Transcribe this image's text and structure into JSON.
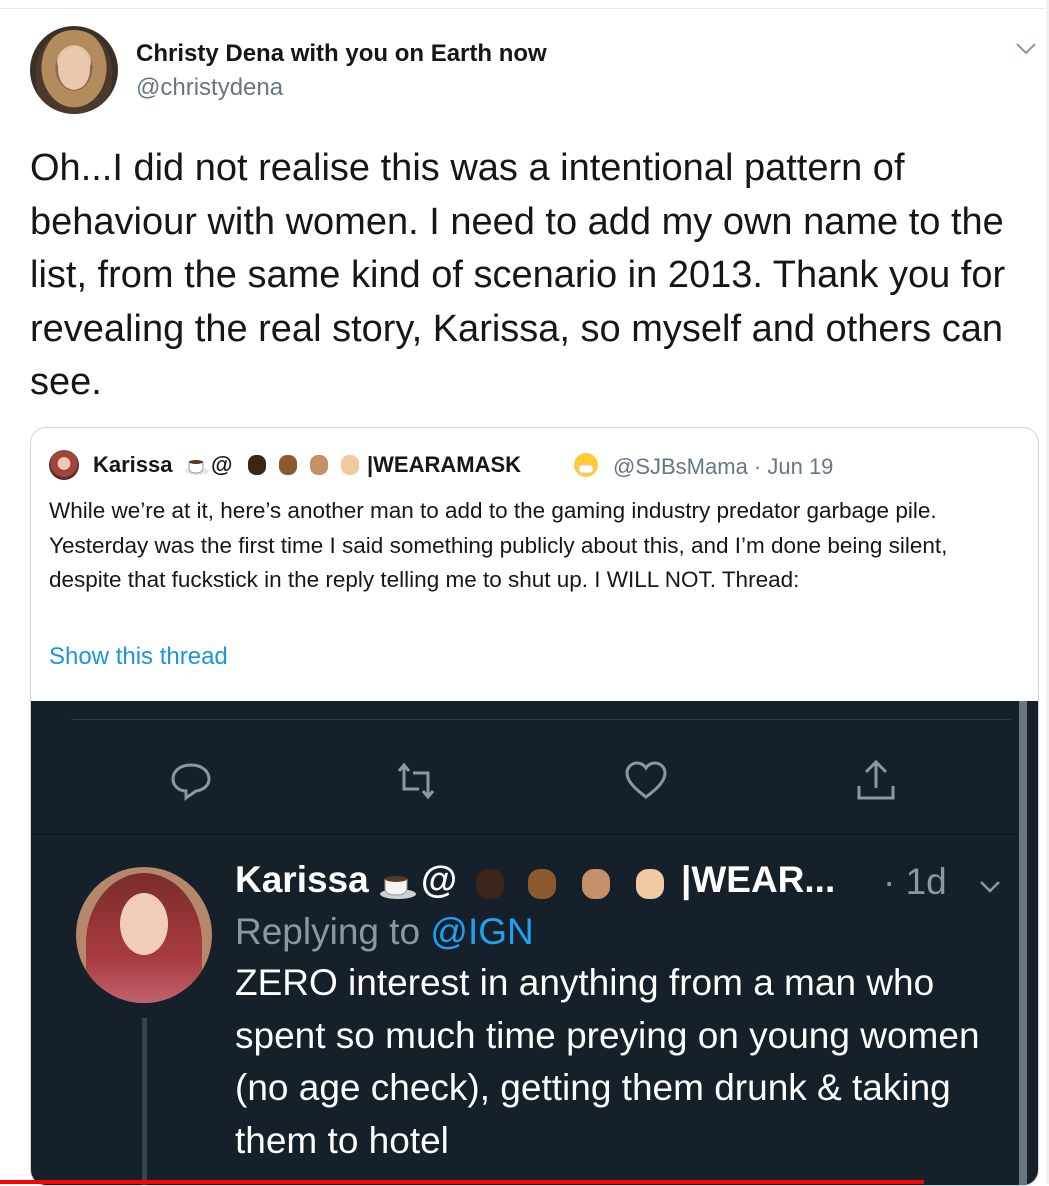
{
  "tweet": {
    "author_name": "Christy Dena with you on Earth now",
    "author_handle": "@christydena",
    "text": "Oh...I did not realise this was a intentional pattern of behaviour with women. I need to add my own name to the list, from the same kind of scenario in 2013. Thank you for revealing the real story, Karissa, so myself and others can see."
  },
  "quote": {
    "name_start": "Karissa",
    "at_symbol": "@",
    "name_suffix": "|WEARAMASK",
    "handle_date": "@SJBsMama · Jun 19",
    "text": "While we’re at it, here’s another man to add to the gaming industry predator garbage pile. Yesterday was the first time I said something publicly about this, and I’m done being silent, despite that fuckstick in the reply telling me to shut up. I WILL NOT. Thread:",
    "show_thread": "Show this thread"
  },
  "video_tweet": {
    "name_start": "Karissa",
    "at_symbol": "@",
    "name_suffix": "|WEAR...",
    "date": "· 1d",
    "replying_prefix": "Replying to",
    "replying_to": "@IGN",
    "text": "ZERO interest in anything from a man who spent so much time preying on young women (no age check), getting them drunk & taking them to hotel"
  },
  "colors": {
    "link_blue": "#1b95e0",
    "dark_bg": "#15202b",
    "mention_blue": "#1da1f2"
  },
  "icons": [
    "chevron-down-icon",
    "reply-icon",
    "retweet-icon",
    "like-icon",
    "share-icon",
    "coffee-emoji-icon",
    "raised-fist-emoji-icon",
    "mask-face-emoji-icon"
  ]
}
